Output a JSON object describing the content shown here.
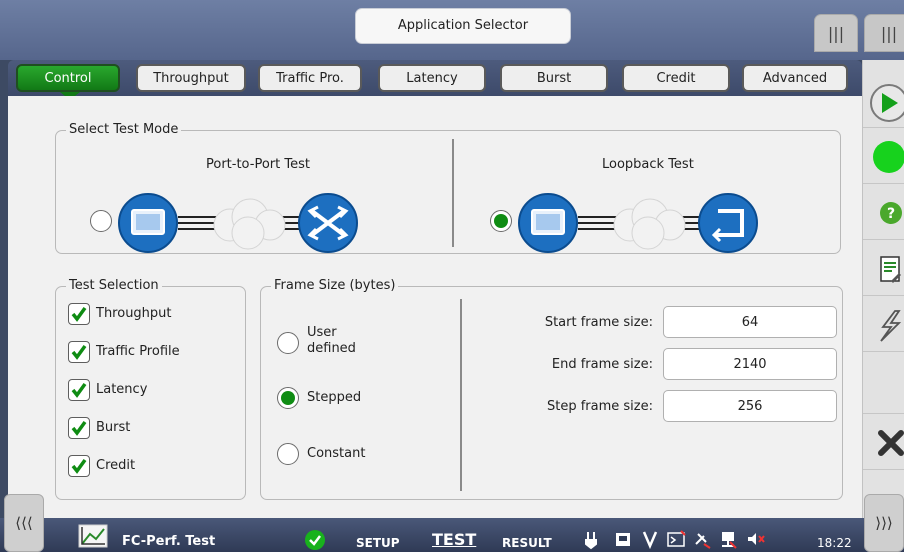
{
  "header": {
    "title": "Application Selector"
  },
  "tabs": [
    {
      "label": "Control",
      "active": true
    },
    {
      "label": "Throughput",
      "active": false
    },
    {
      "label": "Traffic Pro.",
      "active": false
    },
    {
      "label": "Latency",
      "active": false
    },
    {
      "label": "Burst",
      "active": false
    },
    {
      "label": "Credit",
      "active": false
    },
    {
      "label": "Advanced",
      "active": false
    }
  ],
  "test_mode": {
    "title": "Select Test Mode",
    "options": [
      {
        "label": "Port-to-Port Test",
        "selected": false
      },
      {
        "label": "Loopback Test",
        "selected": true
      }
    ]
  },
  "test_selection": {
    "title": "Test Selection",
    "items": [
      {
        "label": "Throughput",
        "checked": true
      },
      {
        "label": "Traffic Profile",
        "checked": true
      },
      {
        "label": "Latency",
        "checked": true
      },
      {
        "label": "Burst",
        "checked": true
      },
      {
        "label": "Credit",
        "checked": true
      }
    ]
  },
  "frame_size": {
    "title": "Frame Size (bytes)",
    "options": [
      {
        "label": "User\ndefined",
        "selected": false
      },
      {
        "label": "Stepped",
        "selected": true
      },
      {
        "label": "Constant",
        "selected": false
      }
    ],
    "fields": [
      {
        "label": "Start frame size:",
        "value": "64"
      },
      {
        "label": "End frame size:",
        "value": "2140"
      },
      {
        "label": "Step frame size:",
        "value": "256"
      }
    ]
  },
  "rail": {
    "icons": [
      "play-icon",
      "status-led-icon",
      "help-icon",
      "report-icon",
      "lightning-icon",
      "blank",
      "close-icon"
    ]
  },
  "bottom": {
    "app_name": "FC-Perf. Test",
    "tabs": [
      "SETUP",
      "TEST",
      "RESULT"
    ],
    "active_tab": "TEST",
    "time": "18:22",
    "left_handle": "⟨⟨⟨",
    "right_handle": "⟩⟩⟩"
  },
  "colors": {
    "accent": "#127916",
    "frame": "#56668c",
    "blue_icon": "#1d6fc0"
  }
}
